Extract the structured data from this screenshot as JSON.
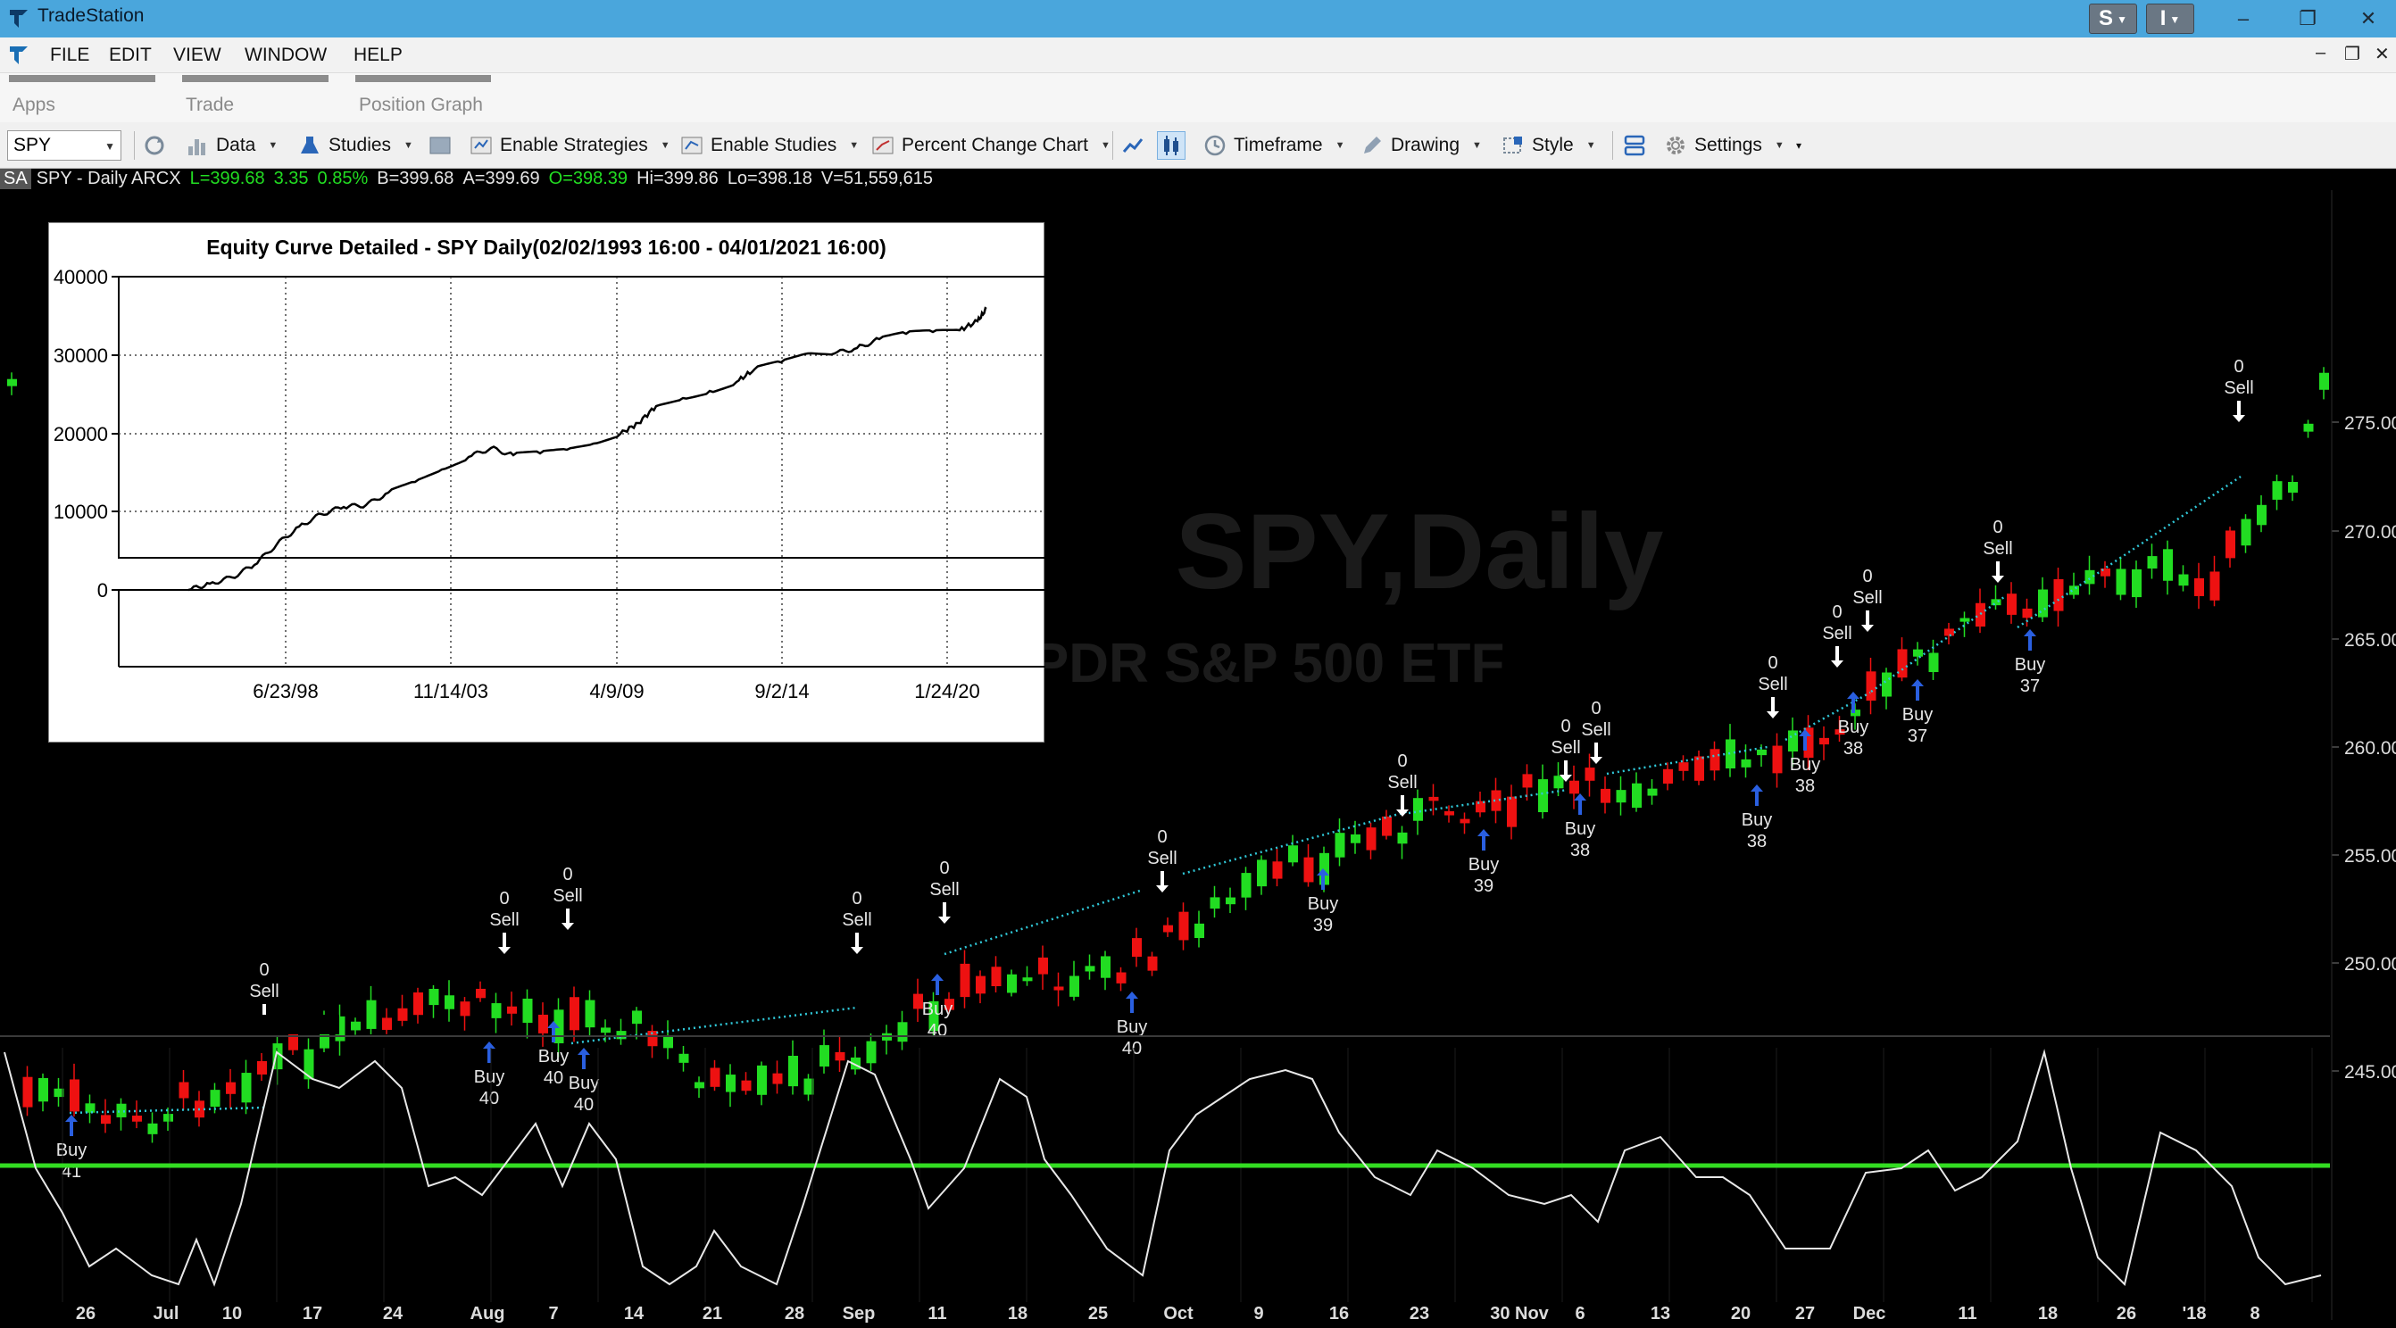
{
  "window": {
    "title": "TradeStation",
    "btn_s": "S",
    "btn_i": "I"
  },
  "menu": [
    "FILE",
    "EDIT",
    "VIEW",
    "WINDOW",
    "HELP"
  ],
  "app_tabs": [
    "Apps",
    "Trade",
    "Position Graph"
  ],
  "toolbar": {
    "symbol": "SPY",
    "data": "Data",
    "studies": "Studies",
    "enable_strategies": "Enable Strategies",
    "enable_studies": "Enable Studies",
    "percent_change": "Percent Change Chart",
    "timeframe": "Timeframe",
    "drawing": "Drawing",
    "style": "Style",
    "settings": "Settings"
  },
  "quote": {
    "badge": "SA",
    "symbol": "SPY - Daily  ARCX",
    "last": "L=399.68",
    "change": "3.35",
    "pct": "0.85%",
    "bid": "B=399.68",
    "ask": "A=399.69",
    "open": "O=398.39",
    "high": "Hi=399.86",
    "low": "Lo=398.18",
    "volume": "V=51,559,615"
  },
  "watermark": {
    "line1": "SPY,Daily",
    "line2": "SPDR S&P 500 ETF"
  },
  "price_axis": [
    "275.00",
    "270.00",
    "265.00",
    "260.00",
    "255.00",
    "250.00",
    "245.00"
  ],
  "date_axis": [
    "26",
    "Jul",
    "10",
    "17",
    "24",
    "Aug",
    "7",
    "14",
    "21",
    "28",
    "Sep",
    "11",
    "18",
    "25",
    "Oct",
    "9",
    "16",
    "23",
    "30 Nov",
    "6",
    "13",
    "20",
    "27",
    "Dec",
    "11",
    "18",
    "26",
    "'18",
    "8"
  ],
  "equity_curve": {
    "title": "Equity Curve Detailed - SPY Daily(02/02/1993 16:00 - 04/01/2021 16:00)",
    "y_ticks": [
      "40000",
      "30000",
      "20000",
      "10000",
      "0"
    ],
    "x_ticks": [
      "6/23/98",
      "11/14/03",
      "4/9/09",
      "9/2/14",
      "1/24/20"
    ]
  },
  "signals": [
    {
      "type": "sell",
      "qty": "0",
      "label": "Sell"
    },
    {
      "type": "buy",
      "qty": "40",
      "label": "Buy"
    },
    {
      "type": "buy",
      "qty": "39",
      "label": "Buy"
    },
    {
      "type": "buy",
      "qty": "38",
      "label": "Buy"
    },
    {
      "type": "buy",
      "qty": "37",
      "label": "Buy"
    },
    {
      "type": "buy",
      "qty": "41",
      "label": "Buy"
    }
  ],
  "colors": {
    "up": "#22dd22",
    "down": "#ee1111",
    "titlebar": "#4aa6dc",
    "signal_line": "#30c8d8",
    "oscillator_line": "#e8e8e8",
    "oscillator_zero": "#33dd22"
  }
}
